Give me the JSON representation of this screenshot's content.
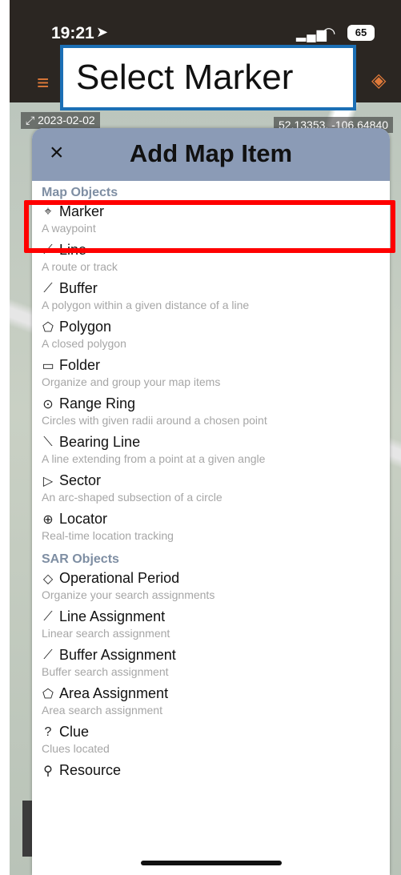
{
  "status": {
    "time": "19:21",
    "battery": "65"
  },
  "callout_text": "Select Marker",
  "map": {
    "date": "2023-02-02",
    "coords": "52.13353, -106.64840"
  },
  "modal": {
    "title": "Add Map Item",
    "close_label": "×",
    "sections": [
      {
        "title": "Map Objects",
        "items": [
          {
            "label": "Marker",
            "sub": "A waypoint",
            "icon": "⌖"
          },
          {
            "label": "Line",
            "sub": "A route or track",
            "icon": "⟋"
          },
          {
            "label": "Buffer",
            "sub": "A polygon within a given distance of a line",
            "icon": "⟋"
          },
          {
            "label": "Polygon",
            "sub": "A closed polygon",
            "icon": "⬠"
          },
          {
            "label": "Folder",
            "sub": "Organize and group your map items",
            "icon": "▭"
          },
          {
            "label": "Range Ring",
            "sub": "Circles with given radii around a chosen point",
            "icon": "⊙"
          },
          {
            "label": "Bearing Line",
            "sub": "A line extending from a point at a given angle",
            "icon": "⟍"
          },
          {
            "label": "Sector",
            "sub": "An arc-shaped subsection of a circle",
            "icon": "▷"
          },
          {
            "label": "Locator",
            "sub": "Real-time location tracking",
            "icon": "⊕"
          }
        ]
      },
      {
        "title": "SAR Objects",
        "items": [
          {
            "label": "Operational Period",
            "sub": "Organize your search assignments",
            "icon": "◇"
          },
          {
            "label": "Line Assignment",
            "sub": "Linear search assignment",
            "icon": "⟋"
          },
          {
            "label": "Buffer Assignment",
            "sub": "Buffer search assignment",
            "icon": "⟋"
          },
          {
            "label": "Area Assignment",
            "sub": "Area search assignment",
            "icon": "⬠"
          },
          {
            "label": "Clue",
            "sub": "Clues located",
            "icon": "?"
          },
          {
            "label": "Resource",
            "sub": "",
            "icon": "⚲"
          }
        ]
      }
    ]
  },
  "colors": {
    "header": "#8b9bb6",
    "section": "#7e8ea3",
    "accent": "#e07a3a",
    "highlight": "#ff0000",
    "callout_border": "#1b6fb5"
  }
}
